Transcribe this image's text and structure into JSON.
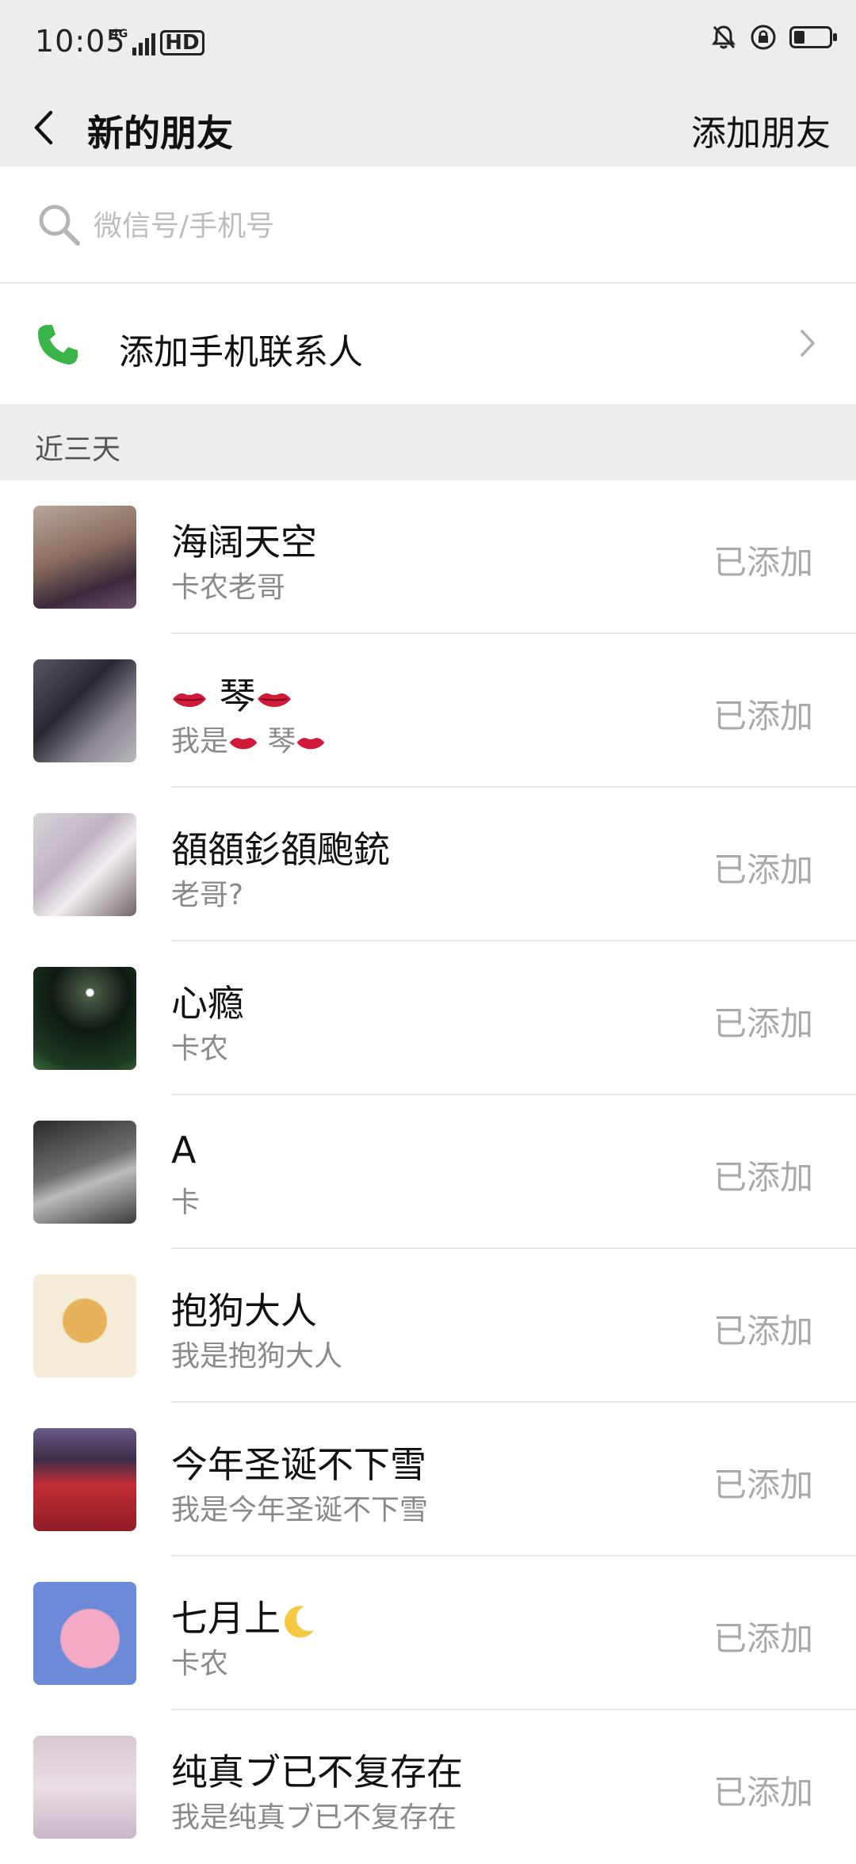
{
  "status_bar": {
    "time": "10:05",
    "network_type": "4G",
    "hd_label": "HD",
    "icons": [
      "signal-icon",
      "mute-bell-icon",
      "lock-rotation-icon",
      "battery-icon"
    ],
    "battery_level": 0.3
  },
  "nav": {
    "back_icon": "chevron-left-icon",
    "title": "新的朋友",
    "action_label": "添加朋友"
  },
  "search": {
    "icon": "search-icon",
    "placeholder": "微信号/手机号",
    "value": ""
  },
  "phone_contacts": {
    "icon": "phone-icon",
    "label": "添加手机联系人",
    "chevron_icon": "chevron-right-icon"
  },
  "section": {
    "label": "近三天"
  },
  "friends": [
    {
      "name": "海阔天空",
      "message": "卡农老哥",
      "status": "已添加"
    },
    {
      "name": "琴",
      "message": "我是",
      "message_suffix": "琴",
      "status": "已添加"
    },
    {
      "name": "頟頟釤頟颮銃",
      "message": "老哥?",
      "status": "已添加"
    },
    {
      "name": "心瘾",
      "message": "卡农",
      "status": "已添加"
    },
    {
      "name": "A",
      "message": "卡",
      "status": "已添加"
    },
    {
      "name": "抱狗大人",
      "message": "我是抱狗大人",
      "status": "已添加"
    },
    {
      "name": "今年圣诞不下雪",
      "message": "我是今年圣诞不下雪",
      "status": "已添加"
    },
    {
      "name": "七月上",
      "message": "卡农",
      "status": "已添加"
    },
    {
      "name": "纯真ブ已不复存在",
      "message": "我是纯真ブ已不复存在",
      "status": "已添加"
    }
  ],
  "colors": {
    "header_bg": "#ededed",
    "phone_icon": "#3bb54a",
    "status_text": "#a9a9a9",
    "lips": "#d11a3a"
  }
}
